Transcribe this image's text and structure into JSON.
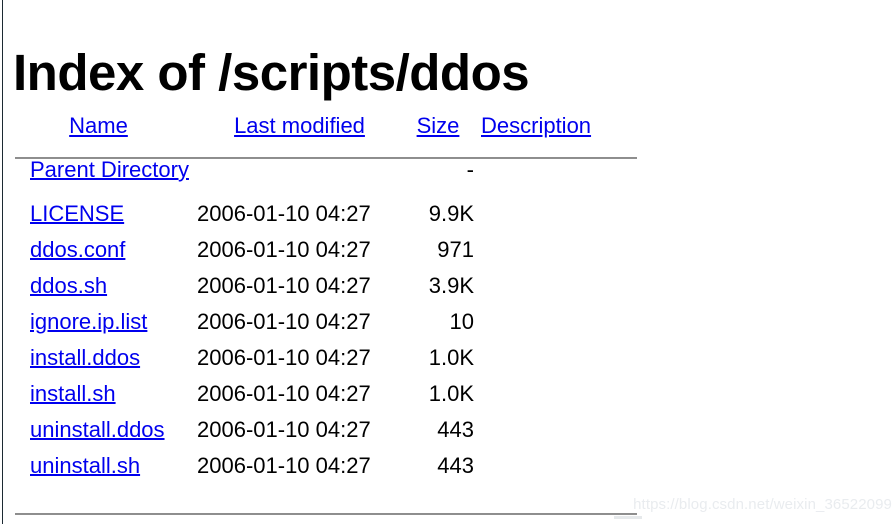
{
  "page": {
    "title": "Index of /scripts/ddos",
    "link_color": "#0000ee",
    "rule_color": "#8f8f8f",
    "background": "#ffffff"
  },
  "table": {
    "headers": [
      {
        "label": "Name",
        "name": "name"
      },
      {
        "label": "Last modified",
        "name": "last-modified"
      },
      {
        "label": "Size",
        "name": "size"
      },
      {
        "label": "Description",
        "name": "description"
      }
    ],
    "rows": [
      {
        "name": "Parent Directory",
        "last_modified": "",
        "size": "-",
        "description": ""
      },
      {
        "name": "LICENSE",
        "last_modified": "2006-01-10 04:27",
        "size": "9.9K",
        "description": ""
      },
      {
        "name": "ddos.conf",
        "last_modified": "2006-01-10 04:27",
        "size": "971",
        "description": ""
      },
      {
        "name": "ddos.sh",
        "last_modified": "2006-01-10 04:27",
        "size": "3.9K",
        "description": ""
      },
      {
        "name": "ignore.ip.list",
        "last_modified": "2006-01-10 04:27",
        "size": "10",
        "description": ""
      },
      {
        "name": "install.ddos",
        "last_modified": "2006-01-10 04:27",
        "size": "1.0K",
        "description": ""
      },
      {
        "name": "install.sh",
        "last_modified": "2006-01-10 04:27",
        "size": "1.0K",
        "description": ""
      },
      {
        "name": "uninstall.ddos",
        "last_modified": "2006-01-10 04:27",
        "size": "443",
        "description": ""
      },
      {
        "name": "uninstall.sh",
        "last_modified": "2006-01-10 04:27",
        "size": "443",
        "description": ""
      }
    ]
  },
  "watermark": {
    "text": "https://blog.csdn.net/weixin_36522099"
  }
}
